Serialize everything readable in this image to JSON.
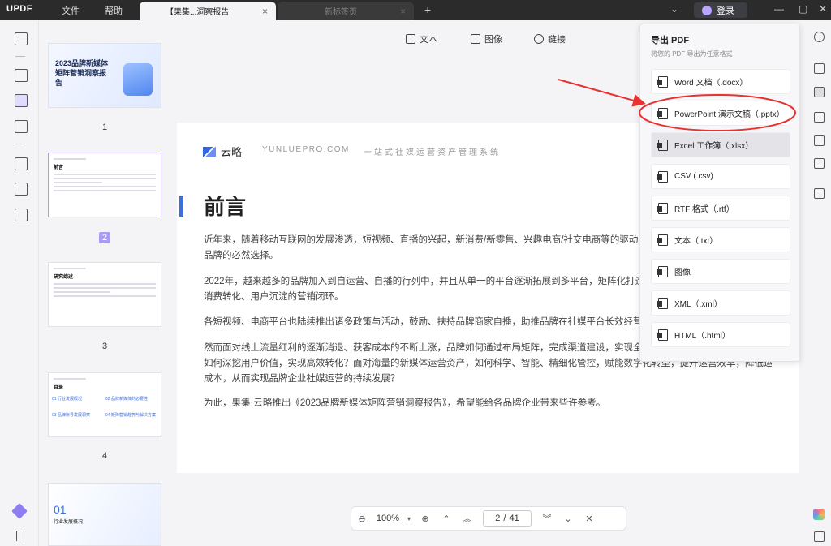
{
  "titlebar": {
    "logo": "UPDF",
    "menu": [
      "文件",
      "帮助"
    ],
    "tabs": [
      {
        "label": "【果集...洞察报告"
      },
      {
        "label": "新标签页"
      }
    ],
    "login": "登录"
  },
  "toolbar": {
    "items": [
      {
        "label": "文本",
        "icon": "text-icon"
      },
      {
        "label": "图像",
        "icon": "image-icon"
      },
      {
        "label": "链接",
        "icon": "link-icon"
      }
    ]
  },
  "thumbnails": [
    {
      "num": "1",
      "title": "2023品牌新媒体矩阵营销洞察报告"
    },
    {
      "num": "2",
      "title": "前言",
      "selected": true
    },
    {
      "num": "3",
      "title": "研究综述"
    },
    {
      "num": "4",
      "title": "目录",
      "items": [
        "01 行业发展概况",
        "02 品牌新媒体的必要性",
        "03 品牌账号发展洞察",
        "04 矩阵营销趋势与解决方案"
      ]
    },
    {
      "num": "",
      "title": "01",
      "sub": "行业发展概况"
    }
  ],
  "page": {
    "brand": "云略",
    "domain": "YUNLUEPRO.COM",
    "slogan": "一站式社媒运营资产管理系统",
    "heading": "前言",
    "paragraphs": [
      "近年来，随着移动互联网的发展渗透，短视频、直播的兴起，新消费/新零售、兴趣电商/社交电商等的驱动下，",
      "品牌的必然选择。",
      "2022年，越来越多的品牌加入到自运营、自播的行列中，并且从单一的平台逐渐拓展到多平台，矩阵化打造",
      "消费转化、用户沉淀的营销闭环。",
      "各短视频、电商平台也陆续推出诸多政策与活动，鼓励、扶持品牌商家自播，助推品牌在社媒平台长效经营。",
      "然而面对线上流量红利的逐渐消退、获客成本的不断上涨，品牌如何通过布局矩阵，完成渠道建设，实现全域",
      "如何深挖用户价值，实现高效转化？面对海量的新媒体运营资产，如何科学、智能、精细化管控，赋能数字化转型，提升运营效率，降低运营",
      "成本，从而实现品牌企业社媒运营的持续发展？",
      "为此，果集·云略推出《2023品牌新媒体矩阵营销洞察报告》，希望能给各品牌企业带来些许参考。"
    ]
  },
  "bottomnav": {
    "zoom": "100%",
    "current": "2",
    "total": "41",
    "sep": "/"
  },
  "export": {
    "title": "导出 PDF",
    "subtitle": "将您的 PDF 导出为任意格式",
    "options": [
      "Word 文档（.docx）",
      "PowerPoint 演示文稿（.pptx）",
      "Excel 工作簿（.xlsx）",
      "CSV (.csv)",
      "RTF 格式（.rtf）",
      "文本（.txt）",
      "图像",
      "XML（.xml）",
      "HTML（.html）"
    ]
  },
  "colors": {
    "accent": "#a89cf2",
    "annotation": "#e8322f",
    "brand": "#3b6fe0"
  }
}
